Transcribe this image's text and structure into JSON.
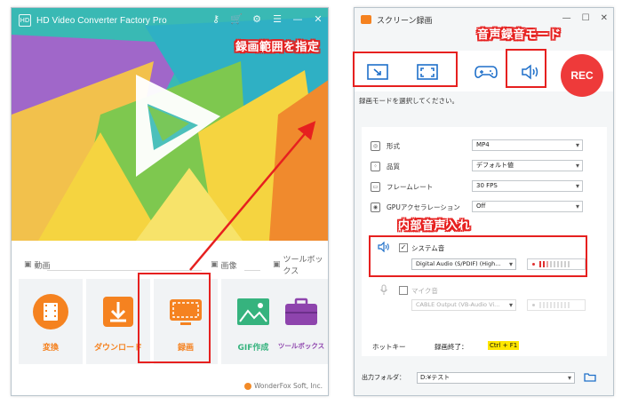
{
  "left_app": {
    "title": "HD Video Converter Factory Pro",
    "logo_letters": "HD",
    "titlebar_icons": [
      "key-icon",
      "cart-icon",
      "gear-icon",
      "menu-icon",
      "minimize-icon",
      "close-icon"
    ],
    "sections": {
      "video": "動画",
      "image": "画像",
      "toolbox": "ツールボックス"
    },
    "tiles": [
      {
        "label": "変換",
        "icon": "film-convert-icon",
        "color": "#f58220"
      },
      {
        "label": "ダウンロード",
        "icon": "download-icon",
        "color": "#f58220"
      },
      {
        "label": "録画",
        "icon": "screen-record-icon",
        "color": "#f58220"
      },
      {
        "label": "GIF作成",
        "icon": "gif-image-icon",
        "color": "#36b37e"
      },
      {
        "label": "ツールボックス",
        "icon": "toolbox-icon",
        "color": "#8e44ad"
      }
    ],
    "footer": "WonderFox Soft, Inc."
  },
  "right_app": {
    "title": "スクリーン録画",
    "toolbar": {
      "rec_label": "REC"
    },
    "hint": "録画モードを選択してください。",
    "settings": [
      {
        "label": "形式",
        "value": "MP4"
      },
      {
        "label": "品質",
        "value": "デフォルト値"
      },
      {
        "label": "フレームレート",
        "value": "30 FPS"
      },
      {
        "label": "GPUアクセラレーション",
        "value": "Off"
      }
    ],
    "system_audio": {
      "checked": true,
      "label": "システム音",
      "device": "Digital Audio (S/PDIF) (High..."
    },
    "mic_audio": {
      "checked": false,
      "label": "マイク音",
      "device": "CABLE Output (VB-Audio Vi..."
    },
    "hotkey": {
      "label": "ホットキー",
      "action": "録画終了：",
      "keys": "Ctrl + F1"
    },
    "output": {
      "label": "出力フォルダ：",
      "path": "D:¥テスト"
    }
  },
  "annotations": {
    "record_range": "録画範囲を指定",
    "audio_mode": "音声録音モード",
    "internal_audio": "内部音声入れ"
  },
  "colors": {
    "accent_orange": "#f58220",
    "annotation_red": "#e6201f",
    "rec_red": "#ee3a3a",
    "toolbar_blue": "#1e6fc9"
  }
}
